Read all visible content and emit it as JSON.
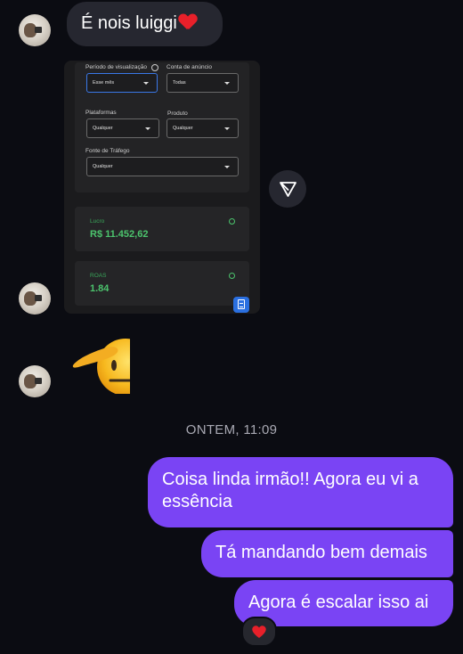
{
  "messages": {
    "msg1": {
      "text": "É nois luiggi",
      "emoji": "heart"
    },
    "timestamp": "ONTEM, 11:09",
    "out1": "Coisa linda irmão!! Agora eu vi a essência",
    "out2": "Tá mandando bem demais",
    "out3": "Agora é escalar isso ai",
    "reaction": "heart"
  },
  "screenshot": {
    "filters": {
      "periodo_label": "Período de visualização",
      "periodo_value": "Esse mês",
      "conta_label": "Conta de anúncio",
      "conta_value": "Todas",
      "plataformas_label": "Plataformas",
      "plataformas_value": "Qualquer",
      "produto_label": "Produto",
      "produto_value": "Qualquer",
      "fonte_label": "Fonte de Tráfego",
      "fonte_value": "Qualquer"
    },
    "metrics": [
      {
        "label": "Lucro",
        "value": "R$ 11.452,62"
      },
      {
        "label": "ROAS",
        "value": "1.84"
      }
    ]
  },
  "colors": {
    "background": "#0b0c12",
    "incoming_bubble": "#262730",
    "outgoing_bubble": "#7a44f4",
    "metric_green": "#4cc46d"
  }
}
